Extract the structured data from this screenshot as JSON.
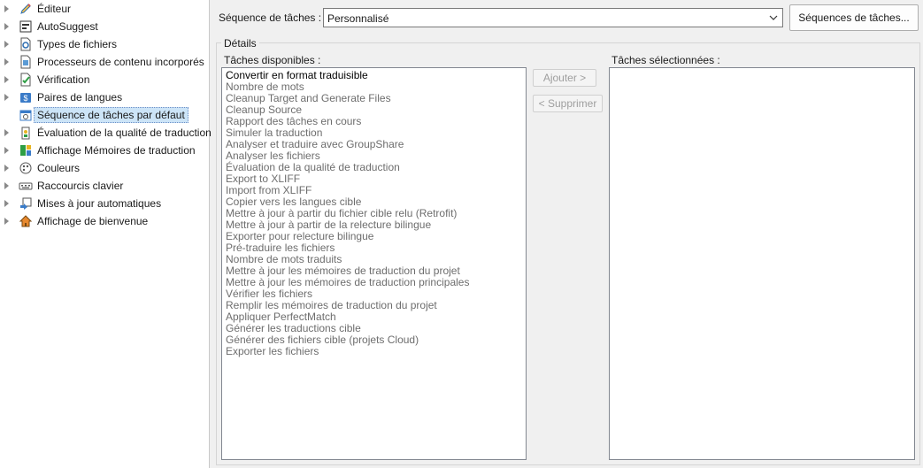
{
  "tree": {
    "items": [
      {
        "label": "Éditeur",
        "icon": "pencil-icon"
      },
      {
        "label": "AutoSuggest",
        "icon": "autosuggest-icon"
      },
      {
        "label": "Types de fichiers",
        "icon": "file-types-icon"
      },
      {
        "label": "Processeurs de contenu incorporés",
        "icon": "embedded-processor-icon"
      },
      {
        "label": "Vérification",
        "icon": "verification-icon"
      },
      {
        "label": "Paires de langues",
        "icon": "language-pairs-icon"
      },
      {
        "label": "Séquence de tâches par défaut",
        "icon": "task-sequence-icon",
        "selected": true
      },
      {
        "label": "Évaluation de la qualité de traduction",
        "icon": "quality-evaluation-icon"
      },
      {
        "label": "Affichage Mémoires de traduction",
        "icon": "tm-view-icon"
      },
      {
        "label": "Couleurs",
        "icon": "palette-icon"
      },
      {
        "label": "Raccourcis clavier",
        "icon": "keyboard-icon"
      },
      {
        "label": "Mises à jour automatiques",
        "icon": "auto-update-icon"
      },
      {
        "label": "Affichage de bienvenue",
        "icon": "home-icon"
      }
    ]
  },
  "sequence": {
    "label": "Séquence de tâches :",
    "selected": "Personnalisé",
    "button": "Séquences de tâches..."
  },
  "details": {
    "title": "Détails",
    "available_label": "Tâches disponibles :",
    "selected_label": "Tâches sélectionnées :",
    "add_button": "Ajouter >",
    "remove_button": "< Supprimer",
    "available_tasks": [
      "Convertir en format traduisible",
      "Nombre de mots",
      "Cleanup Target and Generate Files",
      "Cleanup Source",
      "Rapport des tâches en cours",
      "Simuler la traduction",
      "Analyser et traduire avec GroupShare",
      "Analyser les fichiers",
      "Évaluation de la qualité de traduction",
      "Export to XLIFF",
      "Import from XLIFF",
      "Copier vers les langues cible",
      "Mettre à jour à partir du fichier cible relu (Retrofit)",
      "Mettre à jour à partir de la relecture bilingue",
      "Exporter pour relecture bilingue",
      "Pré-traduire les fichiers",
      "Nombre de mots traduits",
      "Mettre à jour les mémoires de traduction du projet",
      "Mettre à jour les mémoires de traduction principales",
      "Vérifier les fichiers",
      "Remplir les mémoires de traduction du projet",
      "Appliquer PerfectMatch",
      "Générer les traductions cible",
      "Générer des fichiers cible (projets Cloud)",
      "Exporter les fichiers"
    ],
    "selected_tasks": []
  }
}
